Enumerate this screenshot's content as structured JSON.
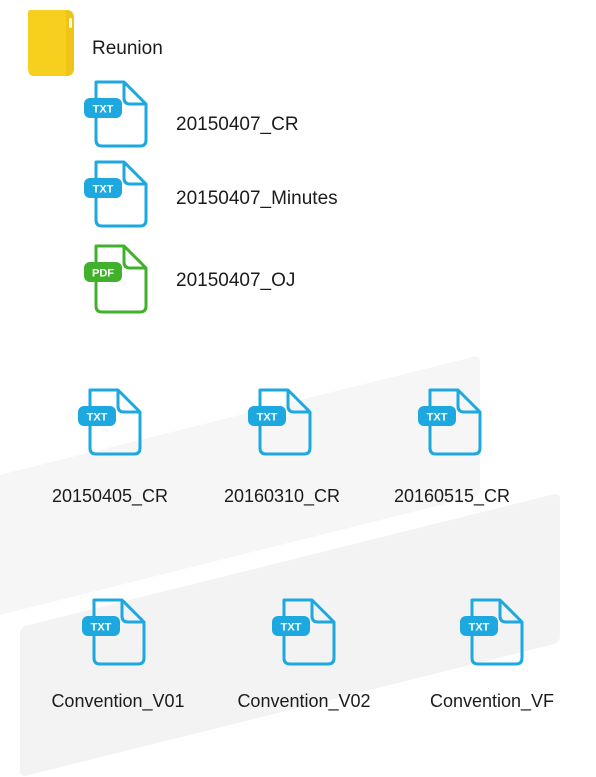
{
  "folder": {
    "name": "Reunion",
    "icon": "folder-icon",
    "color": "#f7cf1e",
    "children": [
      {
        "name": "20150407_CR",
        "type": "TXT",
        "icon": "txt-file-icon"
      },
      {
        "name": "20150407_Minutes",
        "type": "TXT",
        "icon": "txt-file-icon"
      },
      {
        "name": "20150407_OJ",
        "type": "PDF",
        "icon": "pdf-file-icon"
      }
    ]
  },
  "group_cr": [
    {
      "name": "20150405_CR",
      "type": "TXT",
      "icon": "txt-file-icon"
    },
    {
      "name": "20160310_CR",
      "type": "TXT",
      "icon": "txt-file-icon"
    },
    {
      "name": "20160515_CR",
      "type": "TXT",
      "icon": "txt-file-icon"
    }
  ],
  "group_convention": [
    {
      "name": "Convention_V01",
      "type": "TXT",
      "icon": "txt-file-icon"
    },
    {
      "name": "Convention_V02",
      "type": "TXT",
      "icon": "txt-file-icon"
    },
    {
      "name": "Convention_VF",
      "type": "TXT",
      "icon": "txt-file-icon"
    }
  ],
  "colors": {
    "txt": "#1ea8e0",
    "pdf": "#41b02c"
  }
}
